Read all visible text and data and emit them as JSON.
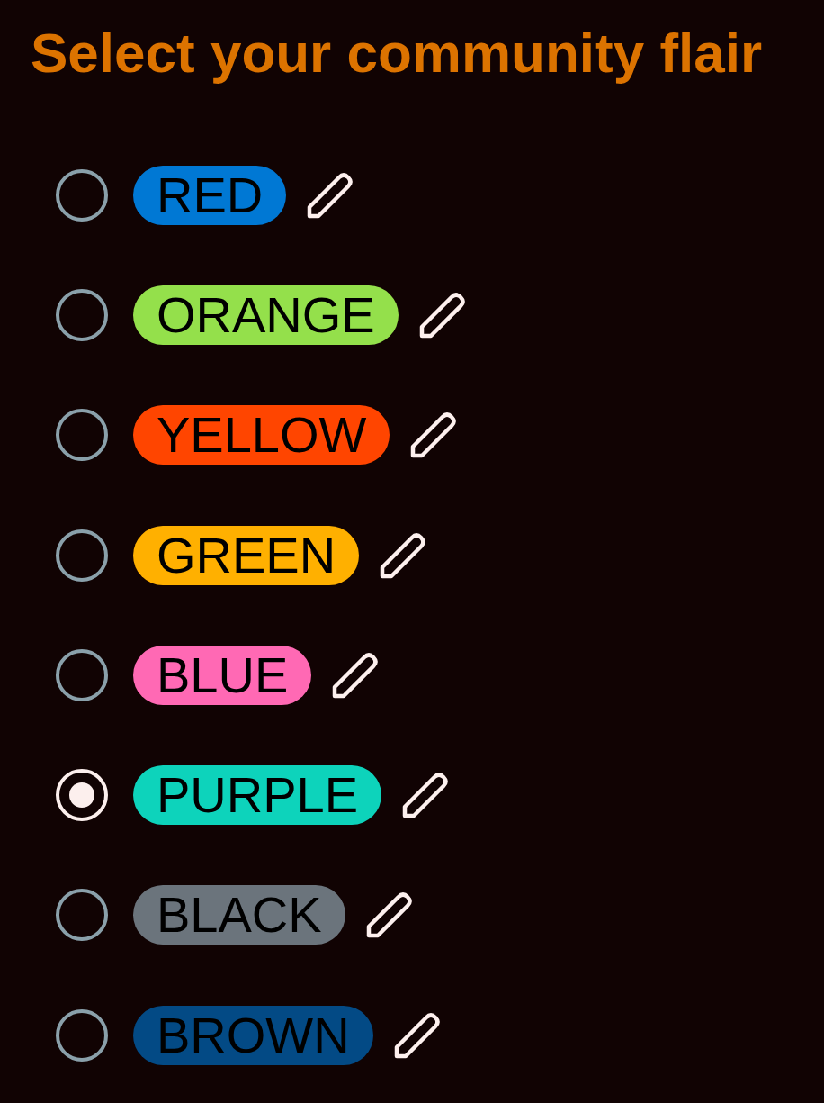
{
  "title": "Select your community flair",
  "flairs": [
    {
      "label": "RED",
      "color": "#0078d4",
      "selected": false
    },
    {
      "label": "ORANGE",
      "color": "#94e04b",
      "selected": false
    },
    {
      "label": "YELLOW",
      "color": "#ff4500",
      "selected": false
    },
    {
      "label": "GREEN",
      "color": "#ffb000",
      "selected": false
    },
    {
      "label": "BLUE",
      "color": "#ff69b4",
      "selected": false
    },
    {
      "label": "PURPLE",
      "color": "#0dd3bb",
      "selected": true
    },
    {
      "label": "BLACK",
      "color": "#6b747c",
      "selected": false
    },
    {
      "label": "BROWN",
      "color": "#034a85",
      "selected": false
    }
  ]
}
